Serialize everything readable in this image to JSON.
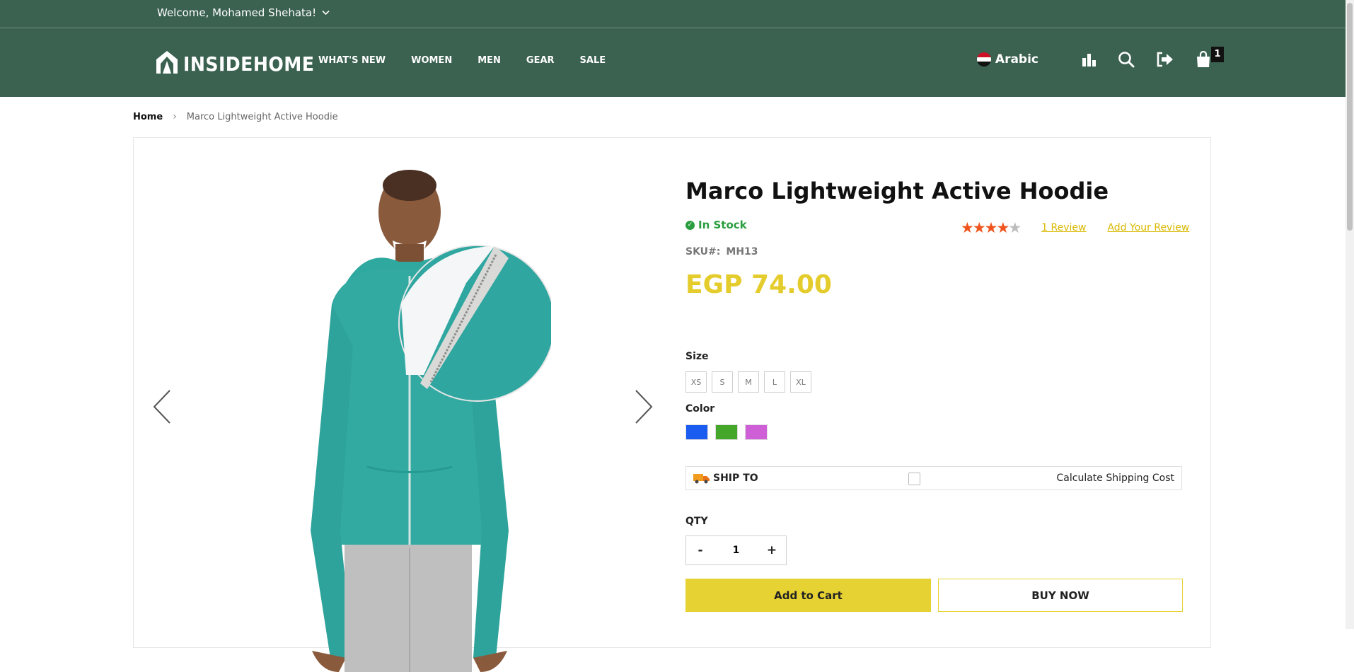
{
  "topbar": {
    "welcome": "Welcome, Mohamed Shehata!"
  },
  "header": {
    "logo_text": "INSIDEHOME",
    "nav": [
      "WHAT'S NEW",
      "WOMEN",
      "MEN",
      "GEAR",
      "SALE"
    ],
    "language": "Arabic",
    "cart_count": "1"
  },
  "breadcrumb": {
    "home": "Home",
    "current": "Marco Lightweight Active Hoodie"
  },
  "product": {
    "title": "Marco Lightweight Active Hoodie",
    "stock": "In Stock",
    "rating": 4,
    "rating_max": 5,
    "reviews_link": "1  Review",
    "add_review": "Add Your Review",
    "sku_label": "SKU#:",
    "sku": "MH13",
    "price": "EGP 74.00",
    "size_label": "Size",
    "sizes": [
      "XS",
      "S",
      "M",
      "L",
      "XL"
    ],
    "color_label": "Color",
    "colors": [
      "#1a5cf0",
      "#45a72a",
      "#cf5fd6"
    ],
    "ship_to": "SHIP TO",
    "calculate_shipping": "Calculate Shipping Cost",
    "qty_label": "QTY",
    "qty_minus": "-",
    "qty_value": "1",
    "qty_plus": "+",
    "add_to_cart": "Add to Cart",
    "buy_now": "BUY NOW"
  },
  "colors": {
    "header_bg": "#3b6151",
    "price": "#e5cc2d",
    "accent": "#e6d232",
    "stock": "#2a9d3f",
    "stars": "#f0541e"
  },
  "icons": [
    "logo-icon",
    "chevron-down-icon",
    "flag-egypt-icon",
    "compare-icon",
    "search-icon",
    "logout-icon",
    "cart-icon",
    "check-icon",
    "truck-icon",
    "broken-image-icon",
    "arrow-left-icon",
    "arrow-right-icon",
    "star-icon"
  ]
}
